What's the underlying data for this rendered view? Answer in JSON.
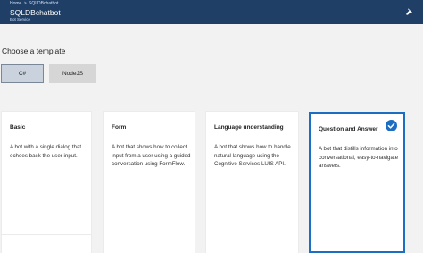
{
  "header": {
    "breadcrumb": [
      "Home",
      "SQLDBchatbot"
    ],
    "breadcrumb_sep": ">",
    "title": "SQLDBchatbot",
    "subtitle": "Bot Service"
  },
  "page": {
    "heading": "Choose a template"
  },
  "languages": {
    "options": [
      "C#",
      "NodeJS"
    ],
    "selected": "C#"
  },
  "templates": [
    {
      "title": "Basic",
      "description": "A bot with a single dialog that echoes back the user input.",
      "selected": false
    },
    {
      "title": "Form",
      "description": "A bot that shows how to collect input from a user using a guided conversation using FormFlow.",
      "selected": false
    },
    {
      "title": "Language understanding",
      "description": "A bot that shows how to handle natural language using the Cognitive Services LUIS API.",
      "selected": false
    },
    {
      "title": "Question and Answer",
      "description": "A bot that distills information into conversational, easy-to-navigate answers.",
      "selected": true
    }
  ],
  "colors": {
    "header_bg": "#1f3f66",
    "accent": "#1b6ec2",
    "content_bg": "#f2f2f2"
  },
  "icons": {
    "pin": "pin-icon",
    "check": "check-circle-icon"
  }
}
